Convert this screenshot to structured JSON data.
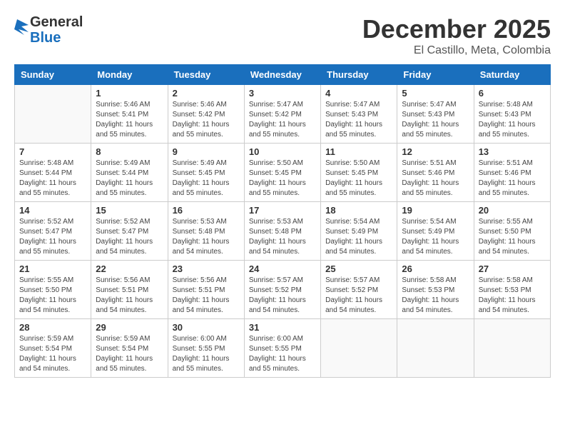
{
  "header": {
    "logo_general": "General",
    "logo_blue": "Blue",
    "title": "December 2025",
    "subtitle": "El Castillo, Meta, Colombia"
  },
  "days_of_week": [
    "Sunday",
    "Monday",
    "Tuesday",
    "Wednesday",
    "Thursday",
    "Friday",
    "Saturday"
  ],
  "weeks": [
    [
      {
        "num": "",
        "info": ""
      },
      {
        "num": "1",
        "info": "Sunrise: 5:46 AM\nSunset: 5:41 PM\nDaylight: 11 hours\nand 55 minutes."
      },
      {
        "num": "2",
        "info": "Sunrise: 5:46 AM\nSunset: 5:42 PM\nDaylight: 11 hours\nand 55 minutes."
      },
      {
        "num": "3",
        "info": "Sunrise: 5:47 AM\nSunset: 5:42 PM\nDaylight: 11 hours\nand 55 minutes."
      },
      {
        "num": "4",
        "info": "Sunrise: 5:47 AM\nSunset: 5:43 PM\nDaylight: 11 hours\nand 55 minutes."
      },
      {
        "num": "5",
        "info": "Sunrise: 5:47 AM\nSunset: 5:43 PM\nDaylight: 11 hours\nand 55 minutes."
      },
      {
        "num": "6",
        "info": "Sunrise: 5:48 AM\nSunset: 5:43 PM\nDaylight: 11 hours\nand 55 minutes."
      }
    ],
    [
      {
        "num": "7",
        "info": "Sunrise: 5:48 AM\nSunset: 5:44 PM\nDaylight: 11 hours\nand 55 minutes."
      },
      {
        "num": "8",
        "info": "Sunrise: 5:49 AM\nSunset: 5:44 PM\nDaylight: 11 hours\nand 55 minutes."
      },
      {
        "num": "9",
        "info": "Sunrise: 5:49 AM\nSunset: 5:45 PM\nDaylight: 11 hours\nand 55 minutes."
      },
      {
        "num": "10",
        "info": "Sunrise: 5:50 AM\nSunset: 5:45 PM\nDaylight: 11 hours\nand 55 minutes."
      },
      {
        "num": "11",
        "info": "Sunrise: 5:50 AM\nSunset: 5:45 PM\nDaylight: 11 hours\nand 55 minutes."
      },
      {
        "num": "12",
        "info": "Sunrise: 5:51 AM\nSunset: 5:46 PM\nDaylight: 11 hours\nand 55 minutes."
      },
      {
        "num": "13",
        "info": "Sunrise: 5:51 AM\nSunset: 5:46 PM\nDaylight: 11 hours\nand 55 minutes."
      }
    ],
    [
      {
        "num": "14",
        "info": "Sunrise: 5:52 AM\nSunset: 5:47 PM\nDaylight: 11 hours\nand 55 minutes."
      },
      {
        "num": "15",
        "info": "Sunrise: 5:52 AM\nSunset: 5:47 PM\nDaylight: 11 hours\nand 54 minutes."
      },
      {
        "num": "16",
        "info": "Sunrise: 5:53 AM\nSunset: 5:48 PM\nDaylight: 11 hours\nand 54 minutes."
      },
      {
        "num": "17",
        "info": "Sunrise: 5:53 AM\nSunset: 5:48 PM\nDaylight: 11 hours\nand 54 minutes."
      },
      {
        "num": "18",
        "info": "Sunrise: 5:54 AM\nSunset: 5:49 PM\nDaylight: 11 hours\nand 54 minutes."
      },
      {
        "num": "19",
        "info": "Sunrise: 5:54 AM\nSunset: 5:49 PM\nDaylight: 11 hours\nand 54 minutes."
      },
      {
        "num": "20",
        "info": "Sunrise: 5:55 AM\nSunset: 5:50 PM\nDaylight: 11 hours\nand 54 minutes."
      }
    ],
    [
      {
        "num": "21",
        "info": "Sunrise: 5:55 AM\nSunset: 5:50 PM\nDaylight: 11 hours\nand 54 minutes."
      },
      {
        "num": "22",
        "info": "Sunrise: 5:56 AM\nSunset: 5:51 PM\nDaylight: 11 hours\nand 54 minutes."
      },
      {
        "num": "23",
        "info": "Sunrise: 5:56 AM\nSunset: 5:51 PM\nDaylight: 11 hours\nand 54 minutes."
      },
      {
        "num": "24",
        "info": "Sunrise: 5:57 AM\nSunset: 5:52 PM\nDaylight: 11 hours\nand 54 minutes."
      },
      {
        "num": "25",
        "info": "Sunrise: 5:57 AM\nSunset: 5:52 PM\nDaylight: 11 hours\nand 54 minutes."
      },
      {
        "num": "26",
        "info": "Sunrise: 5:58 AM\nSunset: 5:53 PM\nDaylight: 11 hours\nand 54 minutes."
      },
      {
        "num": "27",
        "info": "Sunrise: 5:58 AM\nSunset: 5:53 PM\nDaylight: 11 hours\nand 54 minutes."
      }
    ],
    [
      {
        "num": "28",
        "info": "Sunrise: 5:59 AM\nSunset: 5:54 PM\nDaylight: 11 hours\nand 54 minutes."
      },
      {
        "num": "29",
        "info": "Sunrise: 5:59 AM\nSunset: 5:54 PM\nDaylight: 11 hours\nand 55 minutes."
      },
      {
        "num": "30",
        "info": "Sunrise: 6:00 AM\nSunset: 5:55 PM\nDaylight: 11 hours\nand 55 minutes."
      },
      {
        "num": "31",
        "info": "Sunrise: 6:00 AM\nSunset: 5:55 PM\nDaylight: 11 hours\nand 55 minutes."
      },
      {
        "num": "",
        "info": ""
      },
      {
        "num": "",
        "info": ""
      },
      {
        "num": "",
        "info": ""
      }
    ]
  ]
}
